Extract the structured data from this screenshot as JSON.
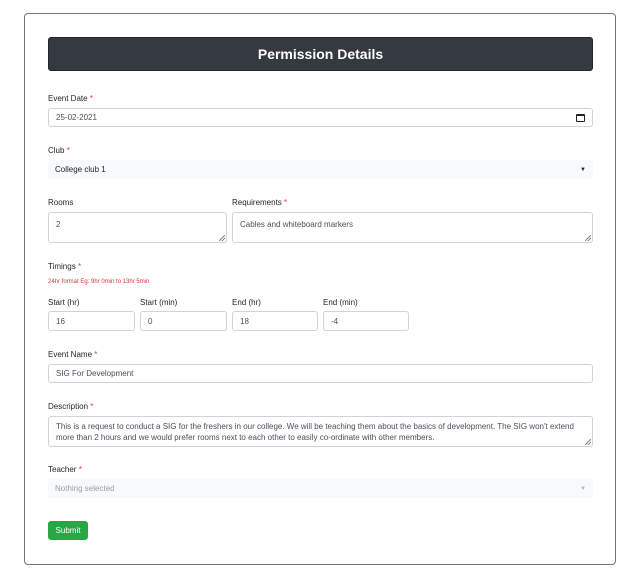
{
  "form": {
    "title": "Permission Details",
    "required_mark": "*",
    "event_date": {
      "label": "Event Date",
      "value": "25-02-2021"
    },
    "club": {
      "label": "Club",
      "value": "College club 1"
    },
    "rooms": {
      "label": "Rooms",
      "value": "2"
    },
    "requirements": {
      "label": "Requirements",
      "value": "Cables and whiteboard markers"
    },
    "timings": {
      "label": "Timings",
      "hint": "24hr format Eg: 9hr 0min to 13hr 5min",
      "start_hr": {
        "label": "Start (hr)",
        "value": "16"
      },
      "start_min": {
        "label": "Start (min)",
        "value": "0"
      },
      "end_hr": {
        "label": "End (hr)",
        "value": "18"
      },
      "end_min": {
        "label": "End (min)",
        "value": "-4"
      }
    },
    "event_name": {
      "label": "Event Name",
      "value": "SIG For Development"
    },
    "description": {
      "label": "Description",
      "value": "This is a request to conduct a SIG for the freshers in our college. We will be teaching them about the basics of development. The SIG won't extend more than 2 hours and we would prefer rooms next to each other to easily co-ordinate with other members."
    },
    "teacher": {
      "label": "Teacher",
      "placeholder": "Nothing selected"
    },
    "submit_label": "Submit"
  },
  "colors": {
    "header_bg": "#343a40",
    "required": "#dc3545",
    "submit_bg": "#28a745"
  },
  "icons": {
    "calendar": "calendar-icon",
    "dropdown": "caret-down-icon"
  }
}
